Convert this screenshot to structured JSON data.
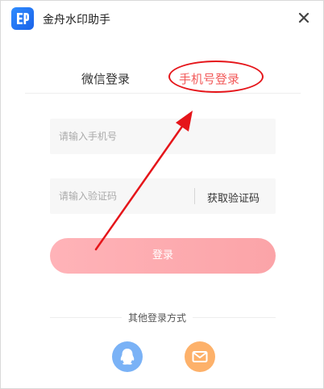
{
  "app": {
    "title": "金舟水印助手",
    "logo_icon": "app-logo-icon",
    "close_icon": "close-icon"
  },
  "tabs": [
    {
      "label": "微信登录",
      "active": false
    },
    {
      "label": "手机号登录",
      "active": true
    }
  ],
  "form": {
    "phone_placeholder": "请输入手机号",
    "code_placeholder": "请输入验证码",
    "get_code_label": "获取验证码",
    "login_label": "登录"
  },
  "other_login": {
    "label": "其他登录方式",
    "options": [
      {
        "icon": "qq-icon"
      },
      {
        "icon": "mail-icon"
      }
    ]
  },
  "colors": {
    "accent": "#f25a5a",
    "annotation_red": "#e5151a",
    "login_button": "#fba4a8",
    "qq_bg": "#7ab2f6",
    "mail_bg": "#fdb16a",
    "logo_bg": "#1a62e8"
  }
}
